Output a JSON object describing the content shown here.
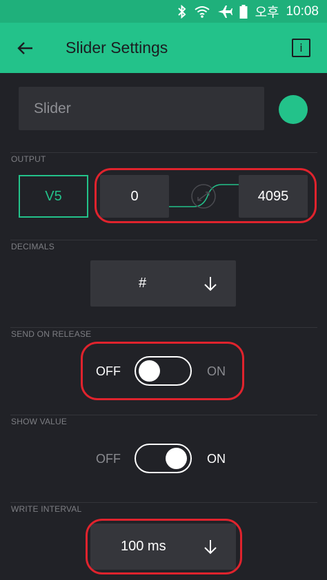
{
  "status_bar": {
    "time_period": "오후",
    "time": "10:08",
    "icons": [
      "bluetooth-icon",
      "wifi-icon",
      "airplane-mode-icon",
      "battery-icon"
    ]
  },
  "app_bar": {
    "title": "Slider Settings",
    "back_icon": "arrow-left-icon",
    "info_label": "i",
    "color": "#23c28a"
  },
  "widget": {
    "name_placeholder": "Slider",
    "color": "#23c28a"
  },
  "output": {
    "label": "OUTPUT",
    "pin": "V5",
    "min": "0",
    "max": "4095"
  },
  "decimals": {
    "label": "DECIMALS",
    "value": "#"
  },
  "send_on_release": {
    "label": "SEND ON RELEASE",
    "off_label": "OFF",
    "on_label": "ON",
    "state": "off"
  },
  "show_value": {
    "label": "SHOW VALUE",
    "off_label": "OFF",
    "on_label": "ON",
    "state": "on"
  },
  "write_interval": {
    "label": "WRITE INTERVAL",
    "value": "100 ms"
  },
  "annotation_color": "#e0232d"
}
